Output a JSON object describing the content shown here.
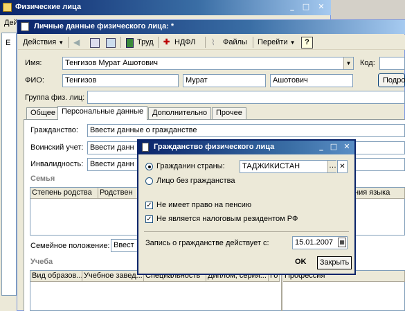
{
  "back_window": {
    "title": "Физические лица",
    "menu_label": "Дей",
    "side_letter": "Е"
  },
  "main_window": {
    "title": "Личные данные физического лица: *",
    "toolbar": {
      "actions": "Действия",
      "trud": "Труд",
      "ndfl": "НДФЛ",
      "files": "Файлы",
      "goto": "Перейти",
      "help": "?"
    },
    "fields": {
      "name_label": "Имя:",
      "name_value": "Тенгизов Мурат Ашотович",
      "code_label": "Код:",
      "fio_label": "ФИО:",
      "surname": "Тенгизов",
      "firstname": "Мурат",
      "patronymic": "Ашотович",
      "podro_button": "Подро",
      "group_label": "Группа физ. лиц:"
    },
    "tabs": [
      "Общее",
      "Персональные данные",
      "Дополнительно",
      "Прочее"
    ],
    "personal": {
      "citizenship_label": "Гражданство:",
      "citizenship_value": "Ввести данные о гражданстве",
      "military_label": "Воинский учет:",
      "military_value": "Ввести данн",
      "disability_label": "Инвалидность:",
      "disability_value": "Ввести данн",
      "family_section": "Семья",
      "family_columns": [
        "Степень родства",
        "Родствен",
        "ния языка"
      ],
      "marital_label": "Семейное положение:",
      "marital_value": "Ввест",
      "study_section": "Учеба",
      "study_columns": [
        "Вид образов...",
        "Учебное завед...",
        "Специальность",
        "Диплом, серия...",
        "Го",
        "Профессия"
      ]
    }
  },
  "dialog": {
    "title": "Гражданство физического лица",
    "radio_citizen": "Гражданин страны:",
    "country_value": "ТАДЖИКИСТАН",
    "radio_stateless": "Лицо без гражданства",
    "check_no_pension": "Не имеет право на пенсию",
    "check_not_resident": "Не является налоговым резидентом РФ",
    "effective_label": "Запись о гражданстве действует с:",
    "effective_date": "15.01.2007",
    "ok_button": "OK",
    "close_button": "Закрыть"
  }
}
